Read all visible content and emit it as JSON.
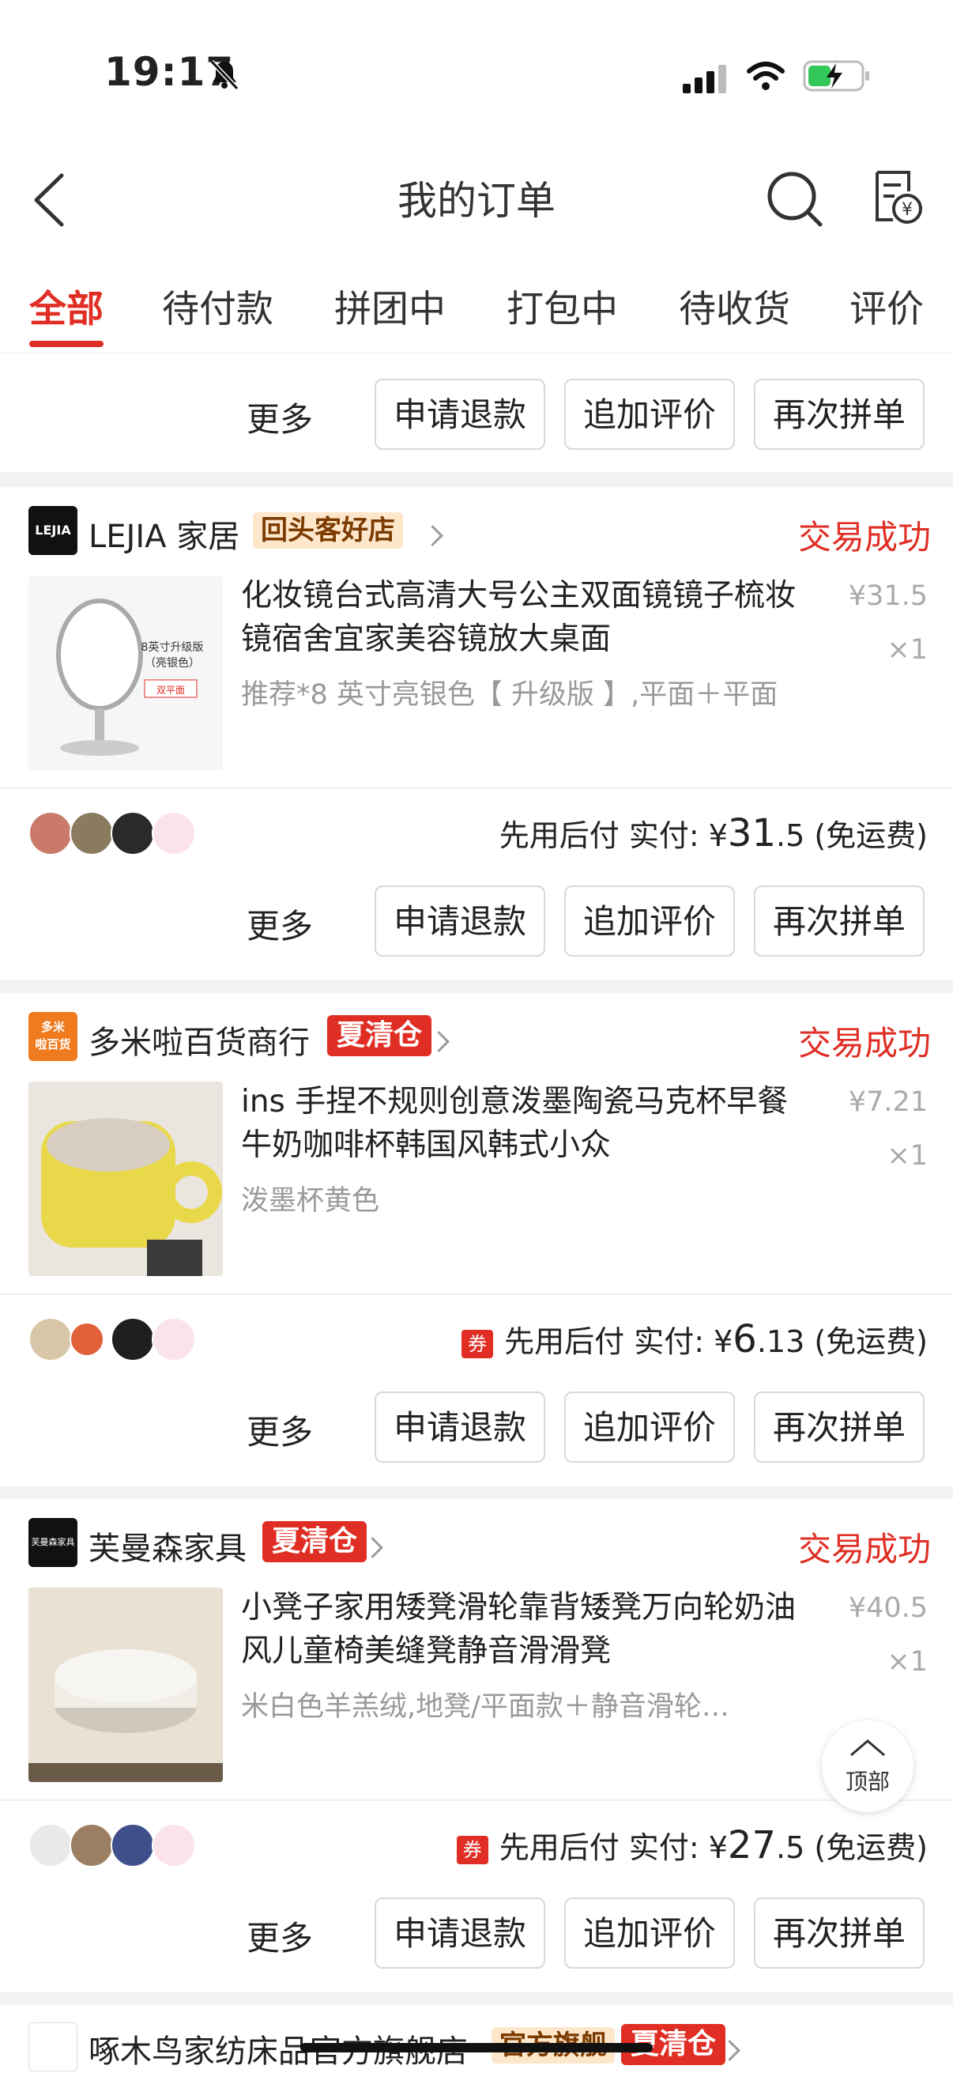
{
  "status_bar": {
    "time": "19:17"
  },
  "header": {
    "title": "我的订单"
  },
  "tabs": [
    {
      "label": "全部",
      "active": true
    },
    {
      "label": "待付款"
    },
    {
      "label": "拼团中"
    },
    {
      "label": "打包中"
    },
    {
      "label": "待收货"
    },
    {
      "label": "评价"
    }
  ],
  "actions": {
    "more": "更多",
    "refund": "申请退款",
    "add_review": "追加评价",
    "reorder": "再次拼单"
  },
  "orders": [
    {
      "store": "LEJIA 家居",
      "store_logo_text": "LEJIA",
      "store_badge": "回头客好店",
      "status": "交易成功",
      "title": "化妆镜台式高清大号公主双面镜镜子梳妆镜宿舍宜家美容镜放大桌面",
      "sku": "推荐*8 英寸亮银色【 升级版 】,平面＋平面",
      "price_symbol": "¥",
      "price": "31.5",
      "qty": "×1",
      "image_caption": "8英寸升级版\n（亮银色）",
      "image_tag": "双平面",
      "pay_prefix": "先用后付 实付: ",
      "pay_symbol": "¥",
      "pay_int": "31",
      "pay_dec": ".5",
      "pay_suffix": " (免运费)"
    },
    {
      "store": "多米啦百货商行",
      "store_logo_text": "多米\n啦百货",
      "store_badge": "夏清仓",
      "status": "交易成功",
      "title": "ins 手捏不规则创意泼墨陶瓷马克杯早餐牛奶咖啡杯韩国风韩式小众",
      "sku": "泼墨杯黄色",
      "price_symbol": "¥",
      "price": "7.21",
      "qty": "×1",
      "coupon": "券",
      "pay_prefix": "先用后付 实付: ",
      "pay_symbol": "¥",
      "pay_int": "6",
      "pay_dec": ".13",
      "pay_suffix": " (免运费)"
    },
    {
      "store": "芙曼森家具",
      "store_logo_text": "芙曼森家具",
      "store_badge": "夏清仓",
      "status": "交易成功",
      "title": "小凳子家用矮凳滑轮靠背矮凳万向轮奶油风儿童椅美缝凳静音滑滑凳",
      "sku": "米白色羊羔绒,地凳/平面款＋静音滑轮…",
      "price_symbol": "¥",
      "price": "40.5",
      "qty": "×1",
      "coupon": "券",
      "pay_prefix": "先用后付 实付: ",
      "pay_symbol": "¥",
      "pay_int": "27",
      "pay_dec": ".5",
      "pay_suffix": " (免运费)"
    }
  ],
  "next_store": {
    "name": "啄木鸟家纺床品官方旗舰店",
    "badge1": "官方旗舰",
    "badge2": "夏清仓"
  },
  "back_to_top": "顶部"
}
